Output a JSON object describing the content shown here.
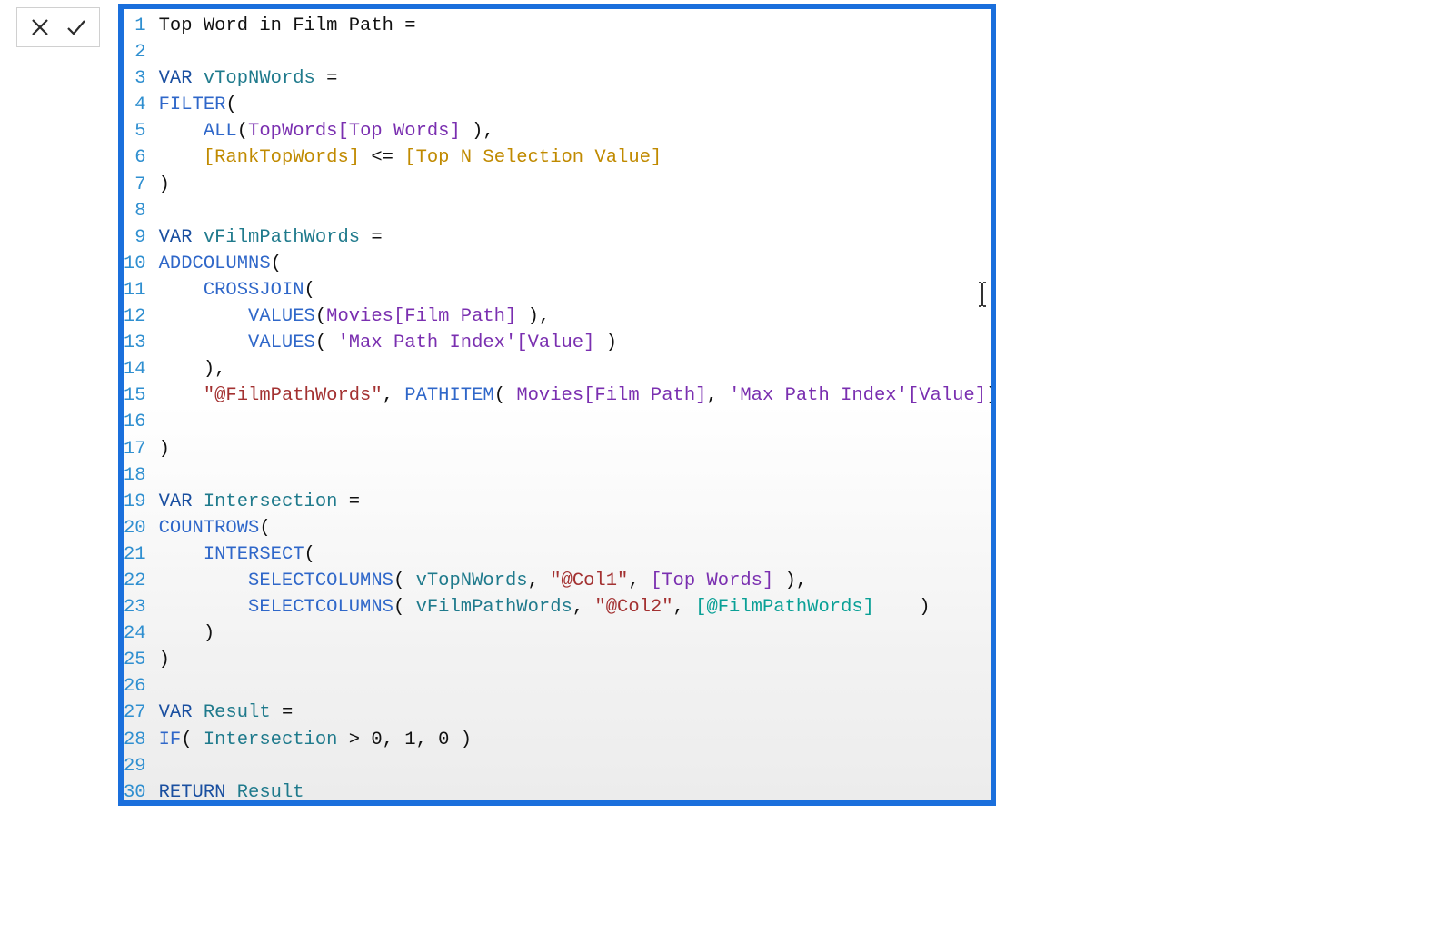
{
  "toolbar": {
    "cancel_title": "Cancel",
    "commit_title": "Commit"
  },
  "editor": {
    "line_count": 30,
    "lines": [
      {
        "n": 1,
        "tokens": [
          {
            "t": "Top Word in Film Path ",
            "c": "t-plain"
          },
          {
            "t": "=",
            "c": "t-plain"
          }
        ]
      },
      {
        "n": 2,
        "tokens": []
      },
      {
        "n": 3,
        "tokens": [
          {
            "t": "VAR",
            "c": "t-keyword"
          },
          {
            "t": " ",
            "c": "t-plain"
          },
          {
            "t": "vTopNWords",
            "c": "t-var"
          },
          {
            "t": " =",
            "c": "t-plain"
          }
        ]
      },
      {
        "n": 4,
        "tokens": [
          {
            "t": "FILTER",
            "c": "t-func"
          },
          {
            "t": "(",
            "c": "t-plain"
          }
        ]
      },
      {
        "n": 5,
        "tokens": [
          {
            "t": "    ",
            "c": "t-plain"
          },
          {
            "t": "ALL",
            "c": "t-func"
          },
          {
            "t": "(",
            "c": "t-plain"
          },
          {
            "t": "TopWords[Top Words]",
            "c": "t-column"
          },
          {
            "t": " ),",
            "c": "t-plain"
          }
        ]
      },
      {
        "n": 6,
        "tokens": [
          {
            "t": "    ",
            "c": "t-plain"
          },
          {
            "t": "[RankTopWords]",
            "c": "t-measure"
          },
          {
            "t": " <= ",
            "c": "t-plain"
          },
          {
            "t": "[Top N Selection Value]",
            "c": "t-measure"
          }
        ]
      },
      {
        "n": 7,
        "tokens": [
          {
            "t": ")",
            "c": "t-plain"
          }
        ]
      },
      {
        "n": 8,
        "tokens": []
      },
      {
        "n": 9,
        "tokens": [
          {
            "t": "VAR",
            "c": "t-keyword"
          },
          {
            "t": " ",
            "c": "t-plain"
          },
          {
            "t": "vFilmPathWords",
            "c": "t-var"
          },
          {
            "t": " =",
            "c": "t-plain"
          }
        ]
      },
      {
        "n": 10,
        "tokens": [
          {
            "t": "ADDCOLUMNS",
            "c": "t-func"
          },
          {
            "t": "(",
            "c": "t-plain"
          }
        ]
      },
      {
        "n": 11,
        "tokens": [
          {
            "t": "    ",
            "c": "t-plain"
          },
          {
            "t": "CROSSJOIN",
            "c": "t-func"
          },
          {
            "t": "(",
            "c": "t-plain"
          }
        ]
      },
      {
        "n": 12,
        "tokens": [
          {
            "t": "        ",
            "c": "t-plain"
          },
          {
            "t": "VALUES",
            "c": "t-func"
          },
          {
            "t": "(",
            "c": "t-plain"
          },
          {
            "t": "Movies[Film Path]",
            "c": "t-column"
          },
          {
            "t": " ),",
            "c": "t-plain"
          }
        ]
      },
      {
        "n": 13,
        "tokens": [
          {
            "t": "        ",
            "c": "t-plain"
          },
          {
            "t": "VALUES",
            "c": "t-func"
          },
          {
            "t": "( ",
            "c": "t-plain"
          },
          {
            "t": "'Max Path Index'[Value]",
            "c": "t-column"
          },
          {
            "t": " )",
            "c": "t-plain"
          }
        ]
      },
      {
        "n": 14,
        "tokens": [
          {
            "t": "    ),",
            "c": "t-plain"
          }
        ]
      },
      {
        "n": 15,
        "tokens": [
          {
            "t": "    ",
            "c": "t-plain"
          },
          {
            "t": "\"@FilmPathWords\"",
            "c": "t-string"
          },
          {
            "t": ", ",
            "c": "t-plain"
          },
          {
            "t": "PATHITEM",
            "c": "t-func"
          },
          {
            "t": "( ",
            "c": "t-plain"
          },
          {
            "t": "Movies[Film Path]",
            "c": "t-column"
          },
          {
            "t": ", ",
            "c": "t-plain"
          },
          {
            "t": "'Max Path Index'[Value]",
            "c": "t-column"
          },
          {
            "t": ")",
            "c": "t-plain"
          }
        ]
      },
      {
        "n": 16,
        "tokens": []
      },
      {
        "n": 17,
        "tokens": [
          {
            "t": ")",
            "c": "t-plain"
          }
        ]
      },
      {
        "n": 18,
        "tokens": []
      },
      {
        "n": 19,
        "tokens": [
          {
            "t": "VAR",
            "c": "t-keyword"
          },
          {
            "t": " ",
            "c": "t-plain"
          },
          {
            "t": "Intersection",
            "c": "t-var"
          },
          {
            "t": " =",
            "c": "t-plain"
          }
        ]
      },
      {
        "n": 20,
        "tokens": [
          {
            "t": "COUNTROWS",
            "c": "t-func"
          },
          {
            "t": "(",
            "c": "t-plain"
          }
        ]
      },
      {
        "n": 21,
        "tokens": [
          {
            "t": "    ",
            "c": "t-plain"
          },
          {
            "t": "INTERSECT",
            "c": "t-func"
          },
          {
            "t": "(",
            "c": "t-plain"
          }
        ]
      },
      {
        "n": 22,
        "tokens": [
          {
            "t": "        ",
            "c": "t-plain"
          },
          {
            "t": "SELECTCOLUMNS",
            "c": "t-func"
          },
          {
            "t": "( ",
            "c": "t-plain"
          },
          {
            "t": "vTopNWords",
            "c": "t-var"
          },
          {
            "t": ", ",
            "c": "t-plain"
          },
          {
            "t": "\"@Col1\"",
            "c": "t-string"
          },
          {
            "t": ", ",
            "c": "t-plain"
          },
          {
            "t": "[Top Words]",
            "c": "t-column"
          },
          {
            "t": " ),",
            "c": "t-plain"
          }
        ]
      },
      {
        "n": 23,
        "tokens": [
          {
            "t": "        ",
            "c": "t-plain"
          },
          {
            "t": "SELECTCOLUMNS",
            "c": "t-func"
          },
          {
            "t": "( ",
            "c": "t-plain"
          },
          {
            "t": "vFilmPathWords",
            "c": "t-var"
          },
          {
            "t": ", ",
            "c": "t-plain"
          },
          {
            "t": "\"@Col2\"",
            "c": "t-string"
          },
          {
            "t": ", ",
            "c": "t-plain"
          },
          {
            "t": "[@FilmPathWords]",
            "c": "t-teal"
          },
          {
            "t": "    )",
            "c": "t-plain"
          }
        ]
      },
      {
        "n": 24,
        "tokens": [
          {
            "t": "    )",
            "c": "t-plain"
          }
        ]
      },
      {
        "n": 25,
        "tokens": [
          {
            "t": ")",
            "c": "t-plain"
          }
        ]
      },
      {
        "n": 26,
        "tokens": []
      },
      {
        "n": 27,
        "tokens": [
          {
            "t": "VAR",
            "c": "t-keyword"
          },
          {
            "t": " ",
            "c": "t-plain"
          },
          {
            "t": "Result",
            "c": "t-var"
          },
          {
            "t": " =",
            "c": "t-plain"
          }
        ]
      },
      {
        "n": 28,
        "tokens": [
          {
            "t": "IF",
            "c": "t-func"
          },
          {
            "t": "( ",
            "c": "t-plain"
          },
          {
            "t": "Intersection",
            "c": "t-var"
          },
          {
            "t": " > 0, 1, 0 )",
            "c": "t-plain"
          }
        ]
      },
      {
        "n": 29,
        "tokens": []
      },
      {
        "n": 30,
        "tokens": [
          {
            "t": "RETURN",
            "c": "t-keyword"
          },
          {
            "t": " ",
            "c": "t-plain"
          },
          {
            "t": "Result",
            "c": "t-var"
          }
        ]
      }
    ]
  }
}
